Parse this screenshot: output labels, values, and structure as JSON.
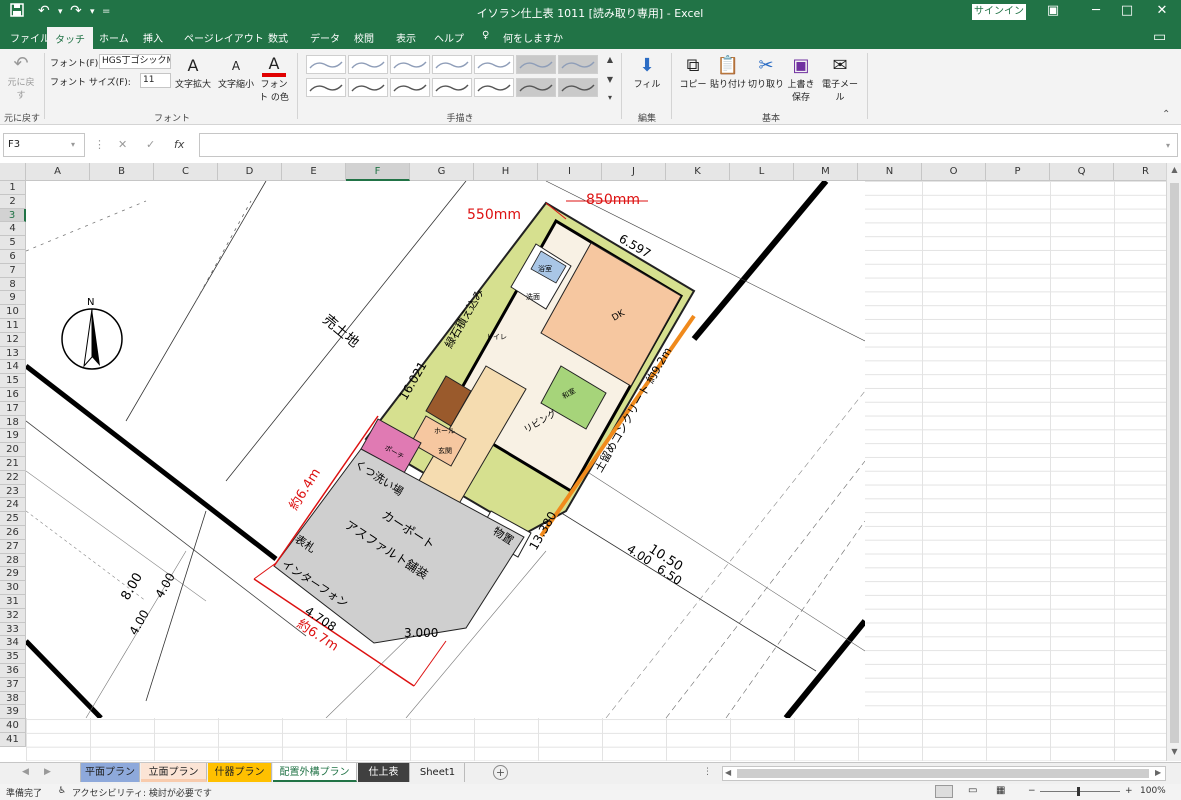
{
  "titlebar": {
    "title": "イソラン仕上表 1011 [読み取り専用] - Excel",
    "signin": "サインイン",
    "minimize": "─",
    "restore": "□",
    "close": "✕",
    "save_icon": "save-icon",
    "undo_icon": "undo-icon",
    "redo_icon": "redo-icon"
  },
  "tabs": [
    {
      "label": "ファイル"
    },
    {
      "label": "タッチ"
    },
    {
      "label": "ホーム"
    },
    {
      "label": "挿入"
    },
    {
      "label": "ページレイアウト"
    },
    {
      "label": "数式"
    },
    {
      "label": "データ"
    },
    {
      "label": "校閲"
    },
    {
      "label": "表示"
    },
    {
      "label": "ヘルプ"
    },
    {
      "label": "何をしますか"
    }
  ],
  "ribbon": {
    "undo": {
      "label1": "元に戻",
      "label2": "す"
    },
    "font_label": "フォント(F):",
    "font_value": "HGS丁ゴシックM",
    "size_label": "フォント サイズ(F):",
    "size_value": "11",
    "enlarge": "文字拡大",
    "shrink": "文字縮小",
    "font_color": "フォント の色",
    "groups": {
      "undo": "元に戻す",
      "font": "フォント",
      "handwriting": "手描き",
      "edit": "編集",
      "basic": "基本"
    },
    "fill": "フィル",
    "copy": "コピー",
    "paste": "貼り付け",
    "cut": "切り取り",
    "overwrite1": "上書き",
    "overwrite2": "保存",
    "email": "電子メール"
  },
  "formula_bar": {
    "name_box": "F3",
    "cancel": "✕",
    "enter": "✓",
    "fx": "fx",
    "value": ""
  },
  "columns": [
    "A",
    "B",
    "C",
    "D",
    "E",
    "F",
    "G",
    "H",
    "I",
    "J",
    "K",
    "L",
    "M",
    "N",
    "O",
    "P",
    "Q",
    "R"
  ],
  "selected_column": "F",
  "rows": [
    "1",
    "2",
    "3",
    "4",
    "5",
    "6",
    "7",
    "8",
    "9",
    "10",
    "11",
    "12",
    "13",
    "14",
    "15",
    "16",
    "17",
    "18",
    "19",
    "20",
    "21",
    "22",
    "23",
    "24",
    "25",
    "26",
    "27",
    "28",
    "29",
    "30",
    "31",
    "32",
    "33",
    "34",
    "35",
    "36",
    "37",
    "38",
    "39",
    "40",
    "41"
  ],
  "selected_row": "3",
  "plan": {
    "dim_550": "550mm",
    "dim_850": "850mm",
    "dim_6597": "6.597",
    "north": "N",
    "lot_label": "売土地",
    "dim_16021": "16.021",
    "dim_13380": "13.380",
    "hedge": "緑石積え込み",
    "concrete": "土留めコンクリート 約9.2m",
    "approx_64": "約6.4m",
    "approx_67": "約6.7m",
    "shoe_wash": "くつ洗い場",
    "carport1": "カーポート",
    "carport2": "アスファルト舗装",
    "mailbox": "表札",
    "intercom": "インターフォン",
    "storage": "物置",
    "dim_4708": "4.708",
    "dim_3000": "3.000",
    "dim_800": "8.00",
    "dim_400a": "4.00",
    "dim_400b": "4.00",
    "dim_1050": "10.50",
    "dim_400c": "4.00",
    "dim_650": "6.50",
    "living": "リビング",
    "ldk": "DK",
    "bath": "浴室",
    "washroom": "洗面",
    "toilet": "トイレ",
    "hall": "ホール",
    "entrance": "玄関",
    "japanese_room": "和室",
    "porch": "ポーチ"
  },
  "sheets": [
    {
      "label": "平面プラン",
      "color": "#8ea9db"
    },
    {
      "label": "立面プラン",
      "color": "#f8cbad"
    },
    {
      "label": "什器プラン",
      "color": "#ffc000"
    },
    {
      "label": "配置外構プラン",
      "color": "#ffffff"
    },
    {
      "label": "仕上表",
      "color": "#404040"
    },
    {
      "label": "Sheet1",
      "color": "#f0f0f0"
    }
  ],
  "statusbar": {
    "ready": "準備完了",
    "accessibility": "アクセシビリティ: 検討が必要です",
    "zoom": "100%"
  }
}
